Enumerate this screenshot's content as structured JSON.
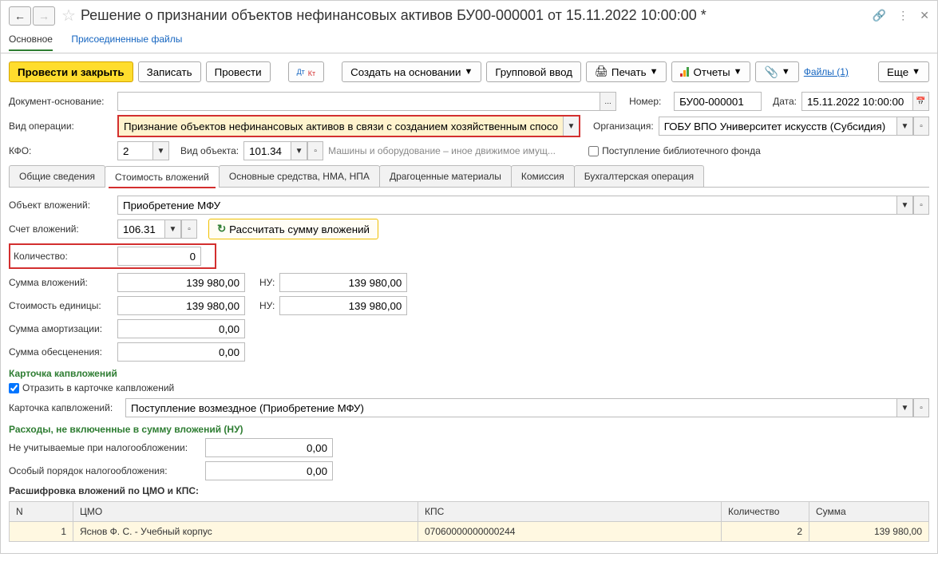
{
  "title": "Решение о признании объектов нефинансовых активов БУ00-000001 от 15.11.2022 10:00:00 *",
  "sections": {
    "main": "Основное",
    "attached": "Присоединенные файлы"
  },
  "toolbar": {
    "post_close": "Провести и закрыть",
    "save": "Записать",
    "post": "Провести",
    "create_based": "Создать на основании",
    "group_input": "Групповой ввод",
    "print": "Печать",
    "reports": "Отчеты",
    "files": "Файлы (1)",
    "more": "Еще"
  },
  "fields": {
    "doc_basis_label": "Документ-основание:",
    "doc_basis_value": "",
    "number_label": "Номер:",
    "number_value": "БУ00-000001",
    "date_label": "Дата:",
    "date_value": "15.11.2022 10:00:00",
    "op_type_label": "Вид операции:",
    "op_type_value": "Признание объектов нефинансовых активов в связи с созданием хозяйственным способом",
    "org_label": "Организация:",
    "org_value": "ГОБУ ВПО Университет искусств (Субсидия)",
    "kfo_label": "КФО:",
    "kfo_value": "2",
    "obj_type_label": "Вид объекта:",
    "obj_type_value": "101.34",
    "obj_type_desc": "Машины и оборудование – иное движимое имущ...",
    "lib_fund": "Поступление библиотечного фонда"
  },
  "tabs": {
    "t1": "Общие сведения",
    "t2": "Стоимость вложений",
    "t3": "Основные средства, НМА, НПА",
    "t4": "Драгоценные материалы",
    "t5": "Комиссия",
    "t6": "Бухгалтерская операция"
  },
  "content": {
    "obj_label": "Объект вложений:",
    "obj_value": "Приобретение МФУ",
    "acct_label": "Счет вложений:",
    "acct_value": "106.31",
    "recalc": "Рассчитать сумму вложений",
    "qty_label": "Количество:",
    "qty_value": "0",
    "sum_label": "Сумма вложений:",
    "sum_value": "139 980,00",
    "nu_label": "НУ:",
    "nu_value": "139 980,00",
    "unit_cost_label": "Стоимость единицы:",
    "unit_cost_value": "139 980,00",
    "nu2_value": "139 980,00",
    "amort_label": "Сумма амортизации:",
    "amort_value": "0,00",
    "impair_label": "Сумма обесценения:",
    "impair_value": "0,00",
    "card_section": "Карточка капвложений",
    "reflect_card": "Отразить в карточке капвложений",
    "card_label": "Карточка капвложений:",
    "card_value": "Поступление возмездное (Приобретение МФУ)",
    "expenses_section": "Расходы, не включенные в сумму вложений (НУ)",
    "tax_excl_label": "Не учитываемые при налогообложении:",
    "tax_excl_value": "0,00",
    "special_tax_label": "Особый порядок налогообложения:",
    "special_tax_value": "0,00",
    "breakdown_title": "Расшифровка вложений по ЦМО и КПС:"
  },
  "table": {
    "headers": {
      "n": "N",
      "cmo": "ЦМО",
      "kps": "КПС",
      "qty": "Количество",
      "sum": "Сумма"
    },
    "rows": [
      {
        "n": "1",
        "cmo": "Яснов Ф. С. - Учебный корпус",
        "kps": "07060000000000244",
        "qty": "2",
        "sum": "139 980,00"
      }
    ]
  }
}
